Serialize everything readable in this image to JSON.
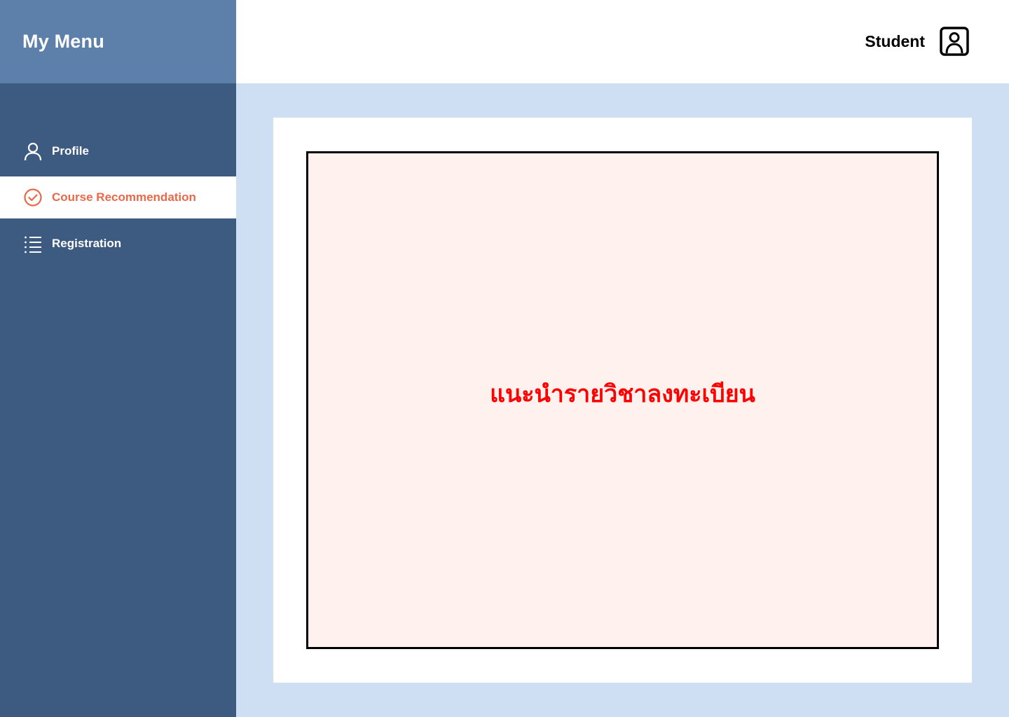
{
  "sidebar": {
    "title": "My Menu",
    "items": [
      {
        "label": "Profile",
        "icon": "user-icon",
        "active": false
      },
      {
        "label": "Course Recommendation",
        "icon": "check-circle-icon",
        "active": true
      },
      {
        "label": "Registration",
        "icon": "list-icon",
        "active": false
      }
    ]
  },
  "header": {
    "user_label": "Student",
    "user_icon": "user-square-icon"
  },
  "main": {
    "heading": "แนะนำรายวิชาลงทะเบียน"
  },
  "colors": {
    "sidebar_bg": "#3d5a80",
    "sidebar_header_bg": "#5d80ab",
    "main_bg": "#cfdff3",
    "active_accent": "#e8694a",
    "content_bg": "#fff1ed",
    "heading_color": "#ff0000"
  }
}
